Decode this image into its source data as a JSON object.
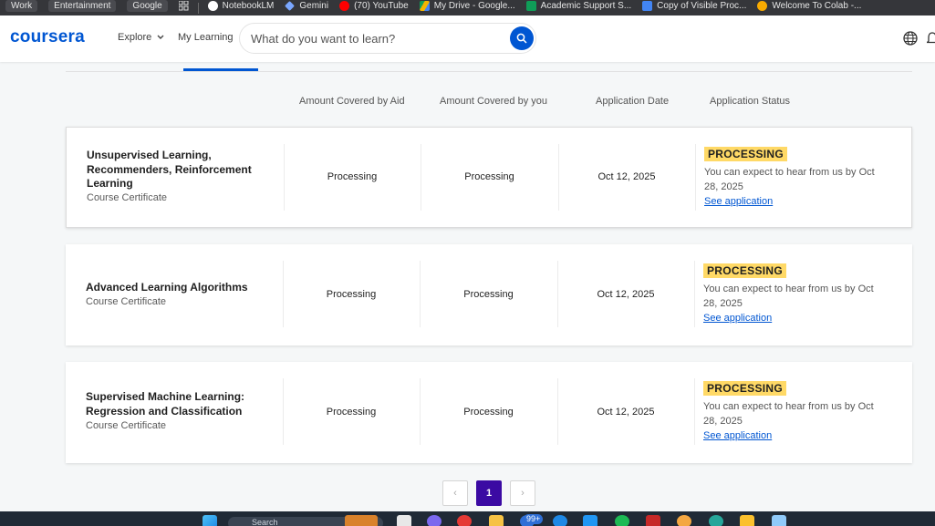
{
  "bookmarks": [
    {
      "label": "Work",
      "pill": true
    },
    {
      "label": "Entertainment",
      "pill": true
    },
    {
      "label": "Google",
      "pill": true
    },
    {
      "label": "NotebookLM",
      "icon": "notebooklm-icon",
      "color": "#ffffff"
    },
    {
      "label": "Gemini",
      "icon": "gemini-icon",
      "color": "#7aa7ff"
    },
    {
      "label": "(70) YouTube",
      "icon": "youtube-icon",
      "color": "#ff0000"
    },
    {
      "label": "My Drive - Google...",
      "icon": "drive-icon",
      "color": "#f4b400"
    },
    {
      "label": "Academic Support S...",
      "icon": "sheets-icon",
      "color": "#0f9d58"
    },
    {
      "label": "Copy of Visible Proc...",
      "icon": "docs-icon",
      "color": "#4285f4"
    },
    {
      "label": "Welcome To Colab -...",
      "icon": "colab-icon",
      "color": "#f9ab00"
    }
  ],
  "header": {
    "logo": "coursera",
    "explore": "Explore",
    "my_learning": "My Learning",
    "search_placeholder": "What do you want to learn?"
  },
  "columns": {
    "aid": "Amount Covered by Aid",
    "you": "Amount Covered by you",
    "date": "Application Date",
    "status": "Application Status"
  },
  "applications": [
    {
      "title": "Unsupervised Learning, Recommenders, Reinforcement Learning",
      "subtitle": "Course Certificate",
      "aid": "Processing",
      "you": "Processing",
      "date": "Oct 12, 2025",
      "status": "PROCESSING",
      "message": "You can expect to hear from us by Oct 28, 2025",
      "link": "See application"
    },
    {
      "title": "Advanced Learning Algorithms",
      "subtitle": "Course Certificate",
      "aid": "Processing",
      "you": "Processing",
      "date": "Oct 12, 2025",
      "status": "PROCESSING",
      "message": "You can expect to hear from us by Oct 28, 2025",
      "link": "See application"
    },
    {
      "title": "Supervised Machine Learning: Regression and Classification",
      "subtitle": "Course Certificate",
      "aid": "Processing",
      "you": "Processing",
      "date": "Oct 12, 2025",
      "status": "PROCESSING",
      "message": "You can expect to hear from us by Oct 28, 2025",
      "link": "See application"
    }
  ],
  "pagination": {
    "prev": "‹",
    "current": "1",
    "next": "›"
  },
  "taskbar": {
    "search_label": "Search",
    "notification_count": "99+"
  },
  "colors": {
    "brand": "#0056d2",
    "badge": "#ffd966",
    "page_active": "#3b0aa3"
  }
}
